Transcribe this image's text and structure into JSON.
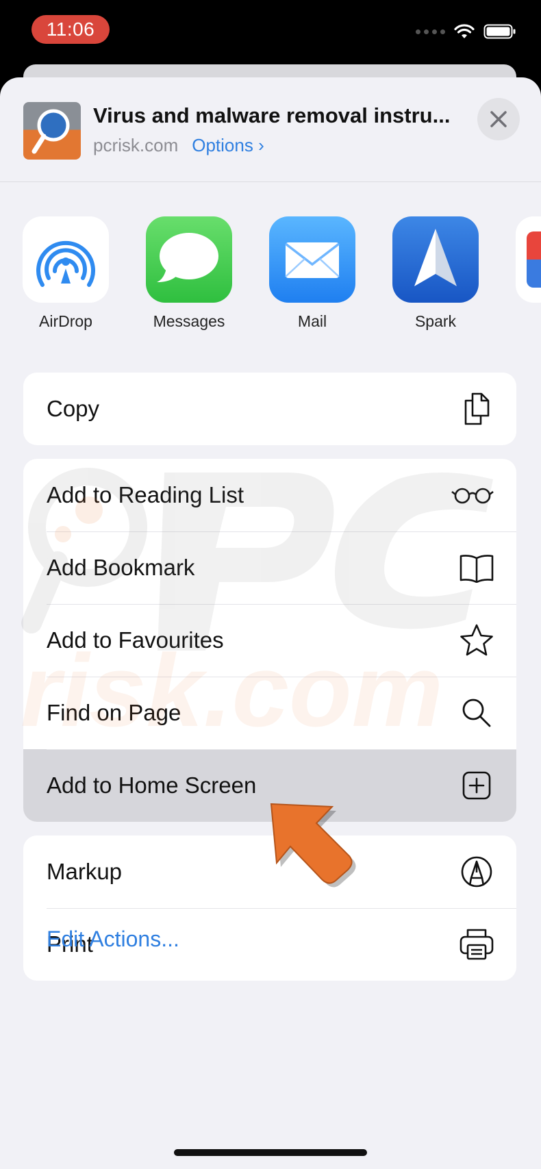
{
  "status_bar": {
    "time": "11:06"
  },
  "header": {
    "title": "Virus and malware removal instru...",
    "domain": "pcrisk.com",
    "options_label": "Options ›"
  },
  "apps": [
    {
      "label": "AirDrop",
      "icon": "airdrop-icon"
    },
    {
      "label": "Messages",
      "icon": "messages-icon"
    },
    {
      "label": "Mail",
      "icon": "mail-icon"
    },
    {
      "label": "Spark",
      "icon": "spark-icon"
    }
  ],
  "actions": {
    "group1": [
      {
        "label": "Copy",
        "icon": "copy-icon"
      }
    ],
    "group2": [
      {
        "label": "Add to Reading List",
        "icon": "glasses-icon"
      },
      {
        "label": "Add Bookmark",
        "icon": "book-icon"
      },
      {
        "label": "Add to Favourites",
        "icon": "star-icon"
      },
      {
        "label": "Find on Page",
        "icon": "search-icon"
      },
      {
        "label": "Add to Home Screen",
        "icon": "plus-square-icon",
        "highlighted": true
      }
    ],
    "group3": [
      {
        "label": "Markup",
        "icon": "markup-icon"
      },
      {
        "label": "Print",
        "icon": "printer-icon"
      }
    ]
  },
  "edit_actions_label": "Edit Actions...",
  "colors": {
    "accent": "#2f7fe0",
    "pointer_arrow": "#e8732c",
    "time_pill": "#d9463b"
  }
}
